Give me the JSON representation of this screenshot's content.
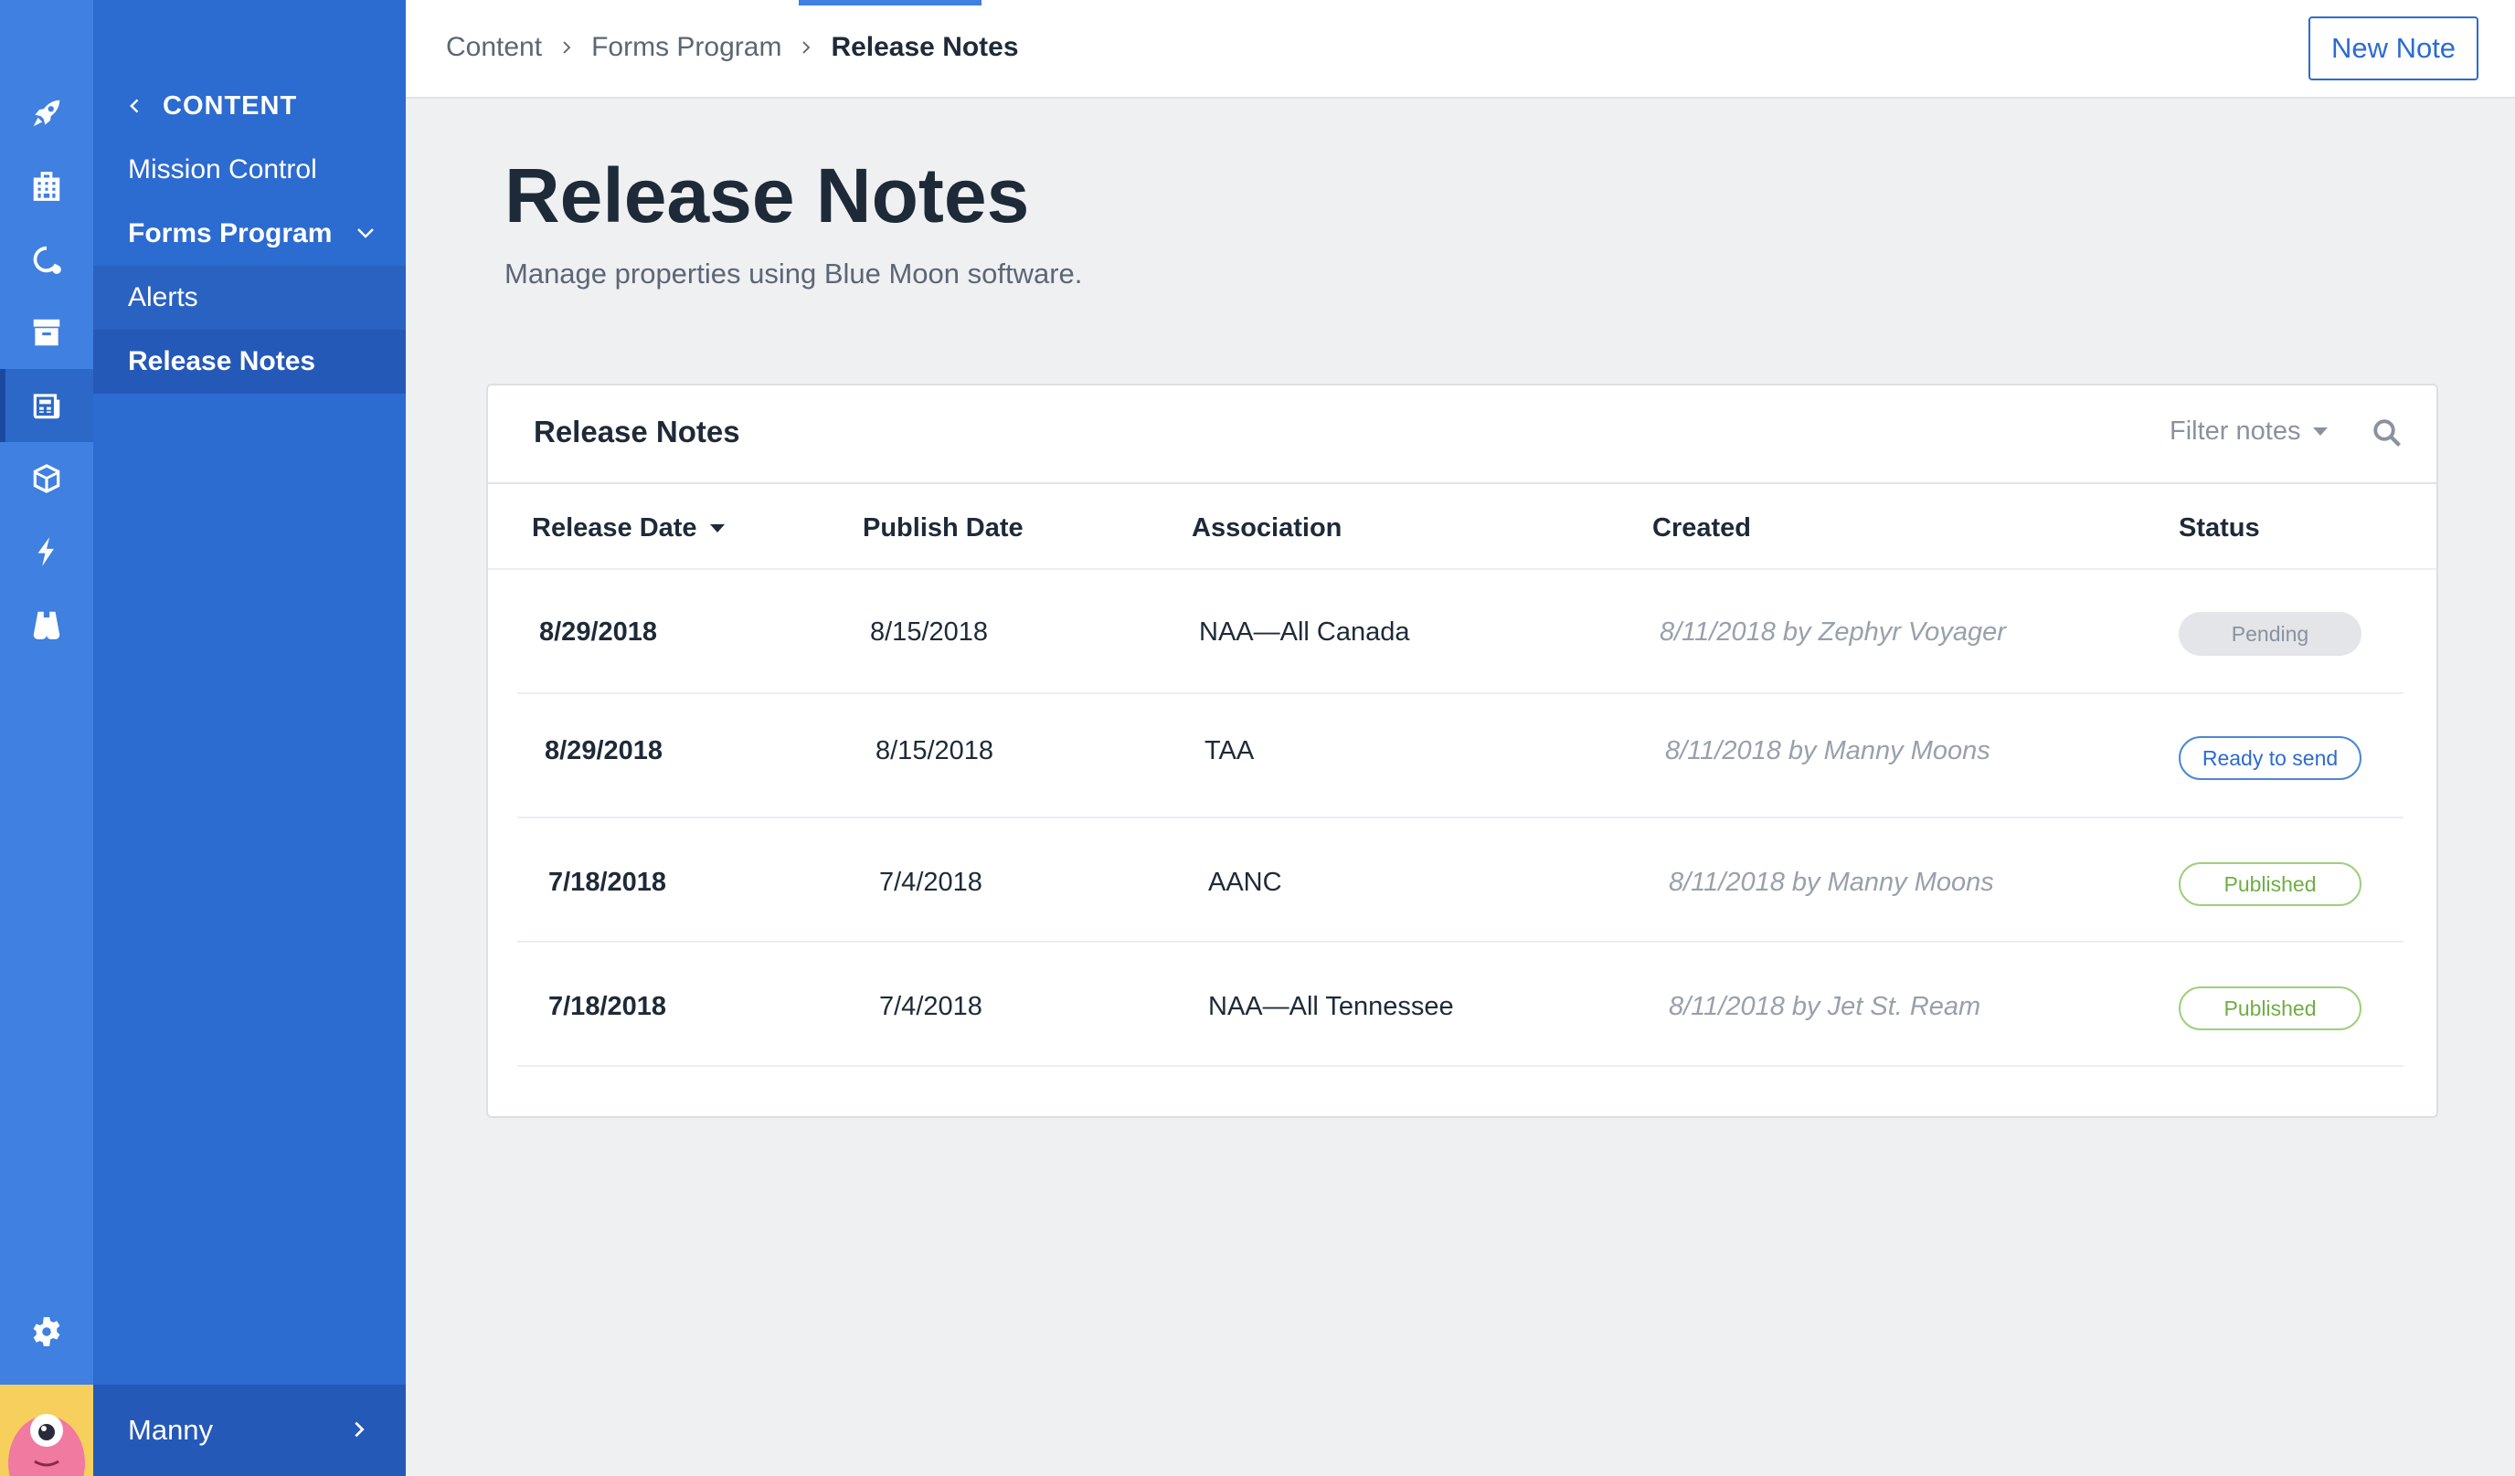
{
  "breadcrumb": [
    "Content",
    "Forms Program",
    "Release Notes"
  ],
  "toolbar": {
    "new_note_label": "New Note"
  },
  "nav": {
    "back_label": "CONTENT",
    "items": [
      {
        "label": "Mission Control"
      },
      {
        "label": "Forms Program"
      },
      {
        "label": "Alerts"
      },
      {
        "label": "Release Notes"
      }
    ],
    "user_name": "Manny"
  },
  "rail": {
    "icons": [
      "rocket-icon",
      "building-icon",
      "refresh-icon",
      "archive-icon",
      "newspaper-icon",
      "cube-icon",
      "bolt-icon",
      "binoculars-icon",
      "gear-icon"
    ],
    "active": "newspaper-icon"
  },
  "page": {
    "title": "Release Notes",
    "subtitle": "Manage properties using Blue Moon software."
  },
  "card": {
    "title": "Release Notes",
    "filter_label": "Filter notes"
  },
  "table": {
    "columns": [
      "Release Date",
      "Publish Date",
      "Association",
      "Created",
      "Status"
    ],
    "rows": [
      {
        "release": "8/29/2018",
        "publish": "8/15/2018",
        "association": "NAA—All Canada",
        "created": "8/11/2018 by Zephyr Voyager",
        "status": "Pending"
      },
      {
        "release": "8/29/2018",
        "publish": "8/15/2018",
        "association": "TAA",
        "created": "8/11/2018 by Manny Moons",
        "status": "Ready to send"
      },
      {
        "release": "7/18/2018",
        "publish": "7/4/2018",
        "association": "AANC",
        "created": "8/11/2018 by Manny Moons",
        "status": "Published"
      },
      {
        "release": "7/18/2018",
        "publish": "7/4/2018",
        "association": "NAA—All Tennessee",
        "created": "8/11/2018 by Jet St. Ream",
        "status": "Published"
      }
    ]
  },
  "colors": {
    "rail": "#3f80e0",
    "nav": "#2c6bd0",
    "accent": "#2c6bd0",
    "pending": "#e3e5e8",
    "published": "#6fae44"
  }
}
